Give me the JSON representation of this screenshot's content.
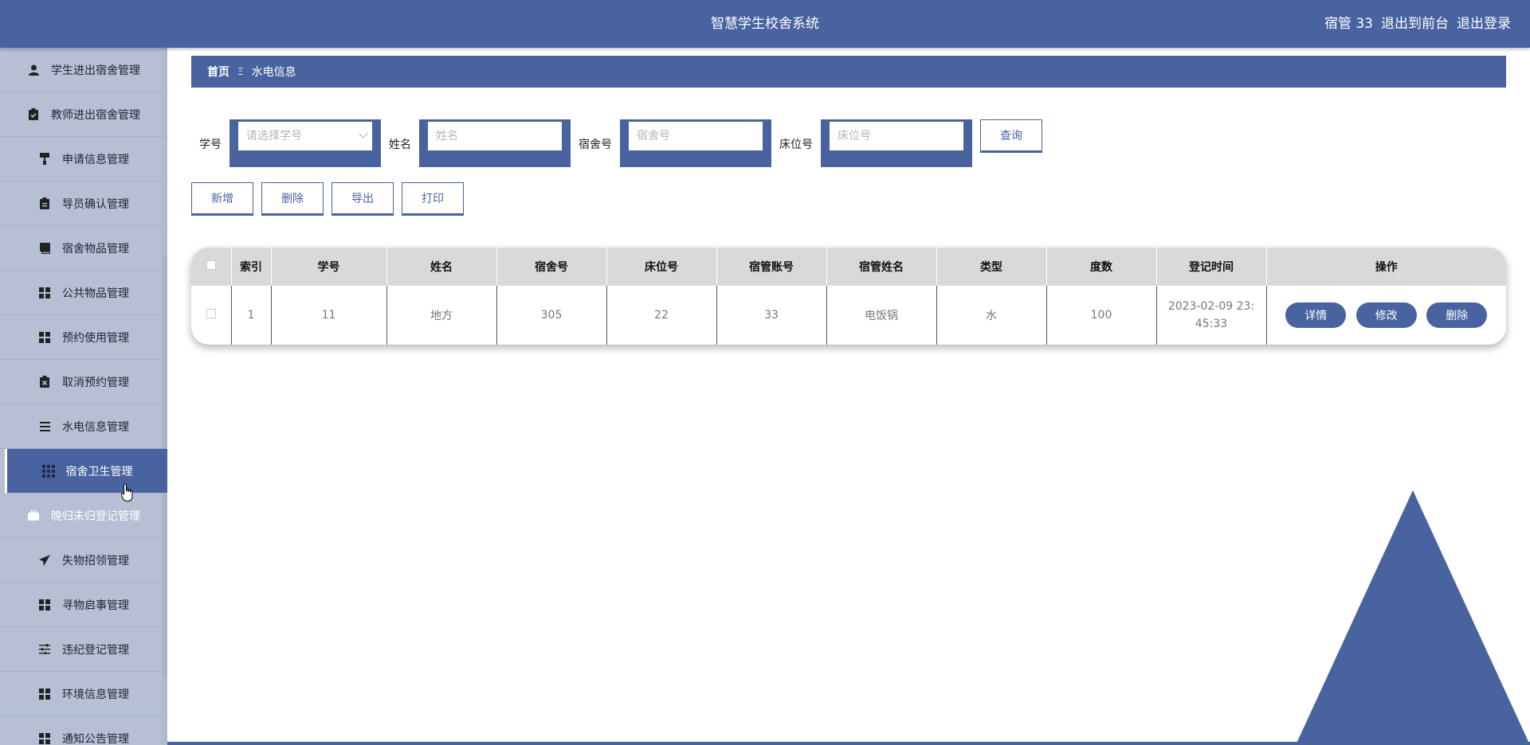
{
  "header": {
    "title": "智慧学生校舍系统",
    "user_label": "宿管 33",
    "back_link": "退出到前台",
    "logout_link": "退出登录"
  },
  "sidebar": {
    "items": [
      {
        "label": "学生进出宿舍管理",
        "icon": "user-icon"
      },
      {
        "label": "教师进出宿舍管理",
        "icon": "clipboard-check-icon"
      },
      {
        "label": "申请信息管理",
        "icon": "paint-roller-icon"
      },
      {
        "label": "导员确认管理",
        "icon": "clipboard-icon"
      },
      {
        "label": "宿舍物品管理",
        "icon": "book-icon"
      },
      {
        "label": "公共物品管理",
        "icon": "grid-icon"
      },
      {
        "label": "预约使用管理",
        "icon": "grid-icon"
      },
      {
        "label": "取消预约管理",
        "icon": "clipboard-x-icon"
      },
      {
        "label": "水电信息管理",
        "icon": "list-icon"
      },
      {
        "label": "宿舍卫生管理",
        "icon": "grid-dots-icon",
        "active": true
      },
      {
        "label": "晚归未归登记管理",
        "icon": "briefcase-icon"
      },
      {
        "label": "失物招领管理",
        "icon": "send-icon"
      },
      {
        "label": "寻物启事管理",
        "icon": "grid-icon"
      },
      {
        "label": "违纪登记管理",
        "icon": "sliders-icon"
      },
      {
        "label": "环境信息管理",
        "icon": "grid-icon"
      },
      {
        "label": "通知公告管理",
        "icon": "grid-icon"
      }
    ]
  },
  "breadcrumb": {
    "home": "首页",
    "separator": "Ξ",
    "current": "水电信息"
  },
  "search": {
    "student_no_label": "学号",
    "student_no_placeholder": "请选择学号",
    "name_label": "姓名",
    "name_placeholder": "姓名",
    "dorm_label": "宿舍号",
    "dorm_placeholder": "宿舍号",
    "bed_label": "床位号",
    "bed_placeholder": "床位号",
    "query_button": "查询"
  },
  "actions": {
    "add": "新增",
    "delete": "删除",
    "export": "导出",
    "print": "打印"
  },
  "table": {
    "headers": [
      "索引",
      "学号",
      "姓名",
      "宿舍号",
      "床位号",
      "宿管账号",
      "宿管姓名",
      "类型",
      "度数",
      "登记时间",
      "操作"
    ],
    "rows": [
      {
        "index": "1",
        "student_no": "11",
        "name": "地方",
        "dorm": "305",
        "bed": "22",
        "manager_account": "33",
        "manager_name": "电饭锅",
        "type": "水",
        "reading": "100",
        "time": "2023-02-09 23:45:33"
      }
    ],
    "op_detail": "详情",
    "op_edit": "修改",
    "op_delete": "删除"
  },
  "colors": {
    "primary": "#4863a0",
    "sidebar_bg": "#b6bfd3",
    "header_row_bg": "#d9d9d9"
  }
}
